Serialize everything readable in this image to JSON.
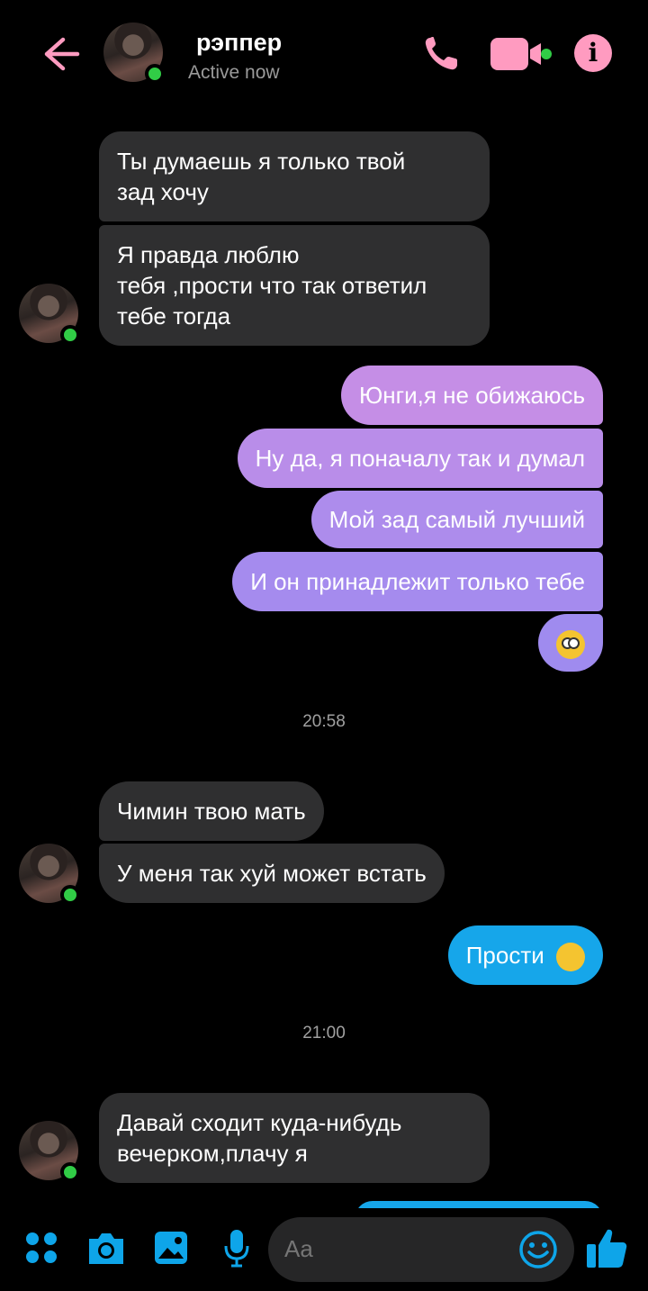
{
  "header": {
    "name": "рэппер",
    "status": "Active now"
  },
  "messages": {
    "m1_lines": [
      "Ты думаешь я только твой",
      "зад хочу"
    ],
    "m2_lines": [
      "Я правда люблю",
      "тебя ,прости что так ответил",
      "тебе тогда"
    ],
    "o1": "Юнги,я не обижаюсь",
    "o2": "Ну да, я поначалу так и думал",
    "o3": "Мой зад самый лучший",
    "o4": "И он принадлежит только тебе",
    "o5_emoji": "flushed-face",
    "time1": "20:58",
    "m3": "Чимин твою мать",
    "m4": "У меня так хуй может встать",
    "o6": "Прости",
    "o6_emoji": "face-with-hand-over-mouth",
    "time2": "21:00",
    "m5_lines": [
      "Давай сходит куда-нибудь",
      "вечерком,плачу я"
    ]
  },
  "composer": {
    "placeholder": "Aa"
  },
  "colors": {
    "accent_pink": "#ff9bc0",
    "accent_blue": "#0ea5e9",
    "incoming_bubble": "#2f2f30",
    "online": "#31cc46"
  },
  "icons": [
    "back-arrow-icon",
    "phone-icon",
    "video-camera-icon",
    "info-icon",
    "menu-dots-icon",
    "camera-icon",
    "gallery-icon",
    "microphone-icon",
    "emoji-icon",
    "thumbs-up-icon"
  ]
}
